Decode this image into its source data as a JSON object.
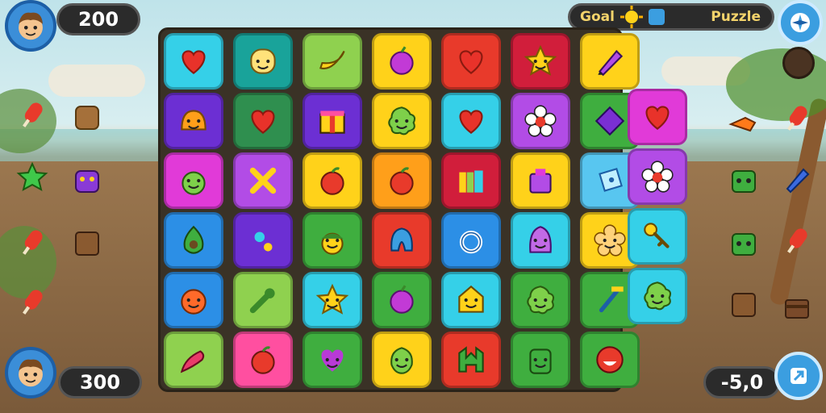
{
  "hud": {
    "top_left_score": "200",
    "bottom_left_score": "300",
    "bottom_right_value": "-5,0",
    "top_bar_left": "Goal",
    "top_bar_right": "Puzzle"
  },
  "colors": {
    "cyan": "#35d0e8",
    "teal": "#19a39a",
    "lime": "#8fd14f",
    "yellow": "#ffd21a",
    "red": "#e83a2b",
    "crimson": "#d11e3b",
    "purple": "#6c2fd3",
    "green": "#3fae3f",
    "magenta": "#e13ad8",
    "violet": "#b24ce6",
    "orange": "#ff9f1a",
    "blue": "#2c8fe6",
    "darkgreen": "#2f8f4f",
    "pink": "#ff4fa0",
    "lightblue": "#58c6f0"
  },
  "grid": [
    [
      {
        "c": "cyan",
        "i": "heart"
      },
      {
        "c": "teal",
        "i": "smiley-blob"
      },
      {
        "c": "lime",
        "i": "banana"
      },
      {
        "c": "yellow",
        "i": "plum"
      },
      {
        "c": "red",
        "i": "heart"
      },
      {
        "c": "crimson",
        "i": "star-face"
      },
      {
        "c": "yellow",
        "i": "pencil"
      }
    ],
    [
      {
        "c": "purple",
        "i": "bell-face"
      },
      {
        "c": "darkgreen",
        "i": "heart"
      },
      {
        "c": "purple",
        "i": "gift"
      },
      {
        "c": "yellow",
        "i": "splat-face"
      },
      {
        "c": "cyan",
        "i": "heart"
      },
      {
        "c": "violet",
        "i": "flower"
      },
      {
        "c": "green",
        "i": "gem"
      }
    ],
    [
      {
        "c": "magenta",
        "i": "apple-face"
      },
      {
        "c": "violet",
        "i": "cross"
      },
      {
        "c": "yellow",
        "i": "apple"
      },
      {
        "c": "orange",
        "i": "apple"
      },
      {
        "c": "crimson",
        "i": "books"
      },
      {
        "c": "yellow",
        "i": "bag"
      },
      {
        "c": "lightblue",
        "i": "ticket"
      }
    ],
    [
      {
        "c": "blue",
        "i": "avocado"
      },
      {
        "c": "purple",
        "i": "dots"
      },
      {
        "c": "green",
        "i": "acorn-face"
      },
      {
        "c": "red",
        "i": "blob-a"
      },
      {
        "c": "blue",
        "i": "ring"
      },
      {
        "c": "cyan",
        "i": "blob-face"
      },
      {
        "c": "yellow",
        "i": "flower-face"
      }
    ],
    [
      {
        "c": "blue",
        "i": "tomato-face"
      },
      {
        "c": "lime",
        "i": "wrench"
      },
      {
        "c": "cyan",
        "i": "star-face"
      },
      {
        "c": "green",
        "i": "plum"
      },
      {
        "c": "cyan",
        "i": "house-face"
      },
      {
        "c": "green",
        "i": "splat-face"
      },
      {
        "c": "green",
        "i": "scraper"
      }
    ],
    [
      {
        "c": "lime",
        "i": "chili"
      },
      {
        "c": "pink",
        "i": "apple"
      },
      {
        "c": "green",
        "i": "heart-face"
      },
      {
        "c": "yellow",
        "i": "pepper-face"
      },
      {
        "c": "red",
        "i": "arch"
      },
      {
        "c": "green",
        "i": "jar-face"
      },
      {
        "c": "green",
        "i": "smile-ball"
      }
    ]
  ],
  "extra_column": [
    {
      "c": "magenta",
      "i": "heart"
    },
    {
      "c": "violet",
      "i": "flower"
    },
    {
      "c": "cyan",
      "i": "key"
    },
    {
      "c": "cyan",
      "i": "splat-face"
    }
  ],
  "left_items": [
    "popsicle-icon",
    "cookie-icon",
    "star-icon",
    "monster-icon",
    "popsicle-icon",
    "toast-icon",
    "popsicle-icon"
  ],
  "right_items": [
    "whistle-icon",
    "popsicle-icon",
    "robot-icon",
    "pencil-icon",
    "robot-icon",
    "popsicle-icon",
    "toast-icon",
    "cake-icon"
  ]
}
